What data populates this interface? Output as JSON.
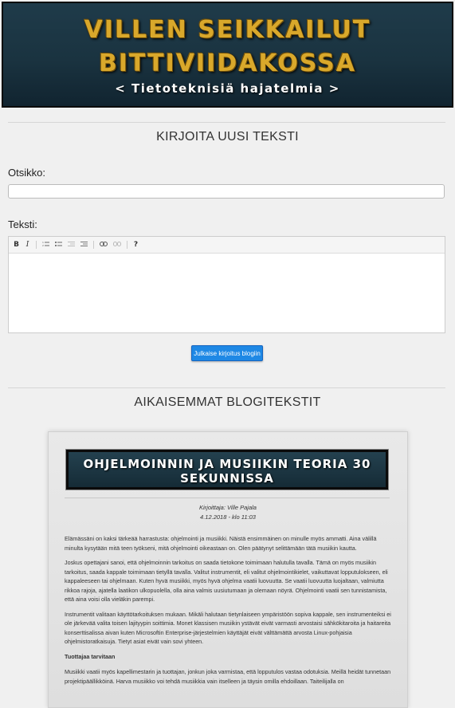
{
  "banner": {
    "title_line1": "VILLEN SEIKKAILUT",
    "title_line2": "BITTIVIIDAKOSSA",
    "subtitle": "< Tietoteknisiä hajatelmia >"
  },
  "new_post": {
    "heading": "KIRJOITA UUSI TEKSTI",
    "title_label": "Otsikko:",
    "title_value": "",
    "text_label": "Teksti:",
    "text_value": "",
    "toolbar": {
      "bold": "B",
      "italic": "I",
      "ordered_list_icon": "ordered-list-icon",
      "unordered_list_icon": "unordered-list-icon",
      "outdent_icon": "outdent-icon",
      "indent_icon": "indent-icon",
      "link_icon": "link-icon",
      "unlink_icon": "unlink-icon",
      "help": "?"
    },
    "publish_label": "Julkaise kirjoitus blogiin",
    "accent_color": "#1e88e5"
  },
  "previous_posts": {
    "heading": "AIKAISEMMAT BLOGITEKSTIT",
    "posts": [
      {
        "title": "OHJELMOINNIN JA MUSIIKIN TEORIA 30 SEKUNNISSA",
        "author": "Kirjoittaja: Ville Pajala",
        "date": "4.12.2018 - klo 11:03",
        "paragraphs": [
          "Elämässäni on kaksi tärkeää harrastusta: ohjelmointi ja musiikki. Näistä ensimmäinen on minulle myös ammatti. Aina välillä minulta kysytään mitä teen työkseni, mitä ohjelmointi oikeastaan on. Olen päätynyt selittämään tätä musiikin kautta.",
          "Joskus opettajani sanoi, että ohjelmoinnin tarkoitus on saada tietokone toimimaan halutulla tavalla. Tämä on myös musiikin tarkoitus, saada kappale toimimaan tietyllä tavalla. Valitut instrumentit, eli valitut ohjelmointikielet, vaikuttavat lopputulokseen, eli kappaleeseen tai ohjelmaan. Kuten hyvä musiikki, myös hyvä ohjelma vaatii luovuutta. Se vaatii luovuutta luojaltaan, valmiutta rikkoa rajoja, ajatella laatikon ulkopuolella, olla aina valmis uusiutumaan ja olemaan nöyrä. Ohjelmointi vaatii sen tunnistamista, että aina voisi olla vieläkin parempi.",
          "Instrumentit valitaan käyttötarkoituksen mukaan. Mikäli halutaan tietynlaiseen ympäristöön sopiva kappale, sen instrumenteiksi ei ole järkevää valita toisen lajityypin soittimia. Monet klassisen musiikin ystävät eivät varmasti arvostaisi sähkökitaroita ja haitareita konserttisalissa aivan kuten Microsoftin Enterprise-järjestelmien käyttäjät eivät välttämättä arvosta Linux-pohjaisia ohjelmistoratkaisuja. Tietyt asiat eivät vain sovi yhteen."
        ],
        "subheading": "Tuottajaa tarvitaan",
        "paragraph_after": "Musiikki vaatii myös kapellimestarin ja tuottajan, jonkun joka varmistaa, että lopputulos vastaa odotuksia. Meillä heidät tunnetaan projektipäällikköinä. Harva musiikko voi tehdä musiikkia vain itselleen ja täysin omilla ehdoillaan. Taiteilijalla on"
      }
    ]
  }
}
